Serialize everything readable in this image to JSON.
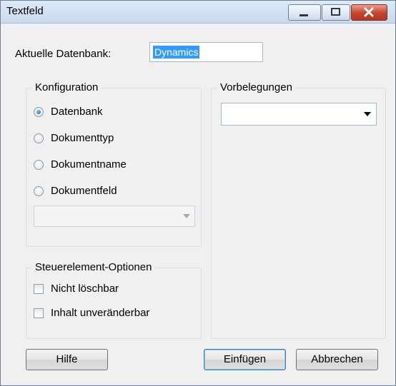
{
  "window": {
    "title": "Textfeld"
  },
  "database": {
    "label": "Aktuelle Datenbank:",
    "value": "Dynamics"
  },
  "configuration": {
    "title": "Konfiguration",
    "options": [
      {
        "label": "Datenbank",
        "selected": true
      },
      {
        "label": "Dokumenttyp",
        "selected": false
      },
      {
        "label": "Dokumentname",
        "selected": false
      },
      {
        "label": "Dokumentfeld",
        "selected": false
      }
    ],
    "combo_value": ""
  },
  "defaults": {
    "title": "Vorbelegungen",
    "combo_value": ""
  },
  "control_options": {
    "title": "Steuerelement-Optionen",
    "checkboxes": [
      {
        "label": "Nicht löschbar",
        "checked": false
      },
      {
        "label": "Inhalt unveränderbar",
        "checked": false
      }
    ]
  },
  "buttons": {
    "help": "Hilfe",
    "insert": "Einfügen",
    "cancel": "Abbrechen"
  },
  "icons": {
    "minimize": "minimize-icon",
    "maximize": "maximize-icon",
    "close": "close-icon",
    "dropdown": "chevron-down-icon"
  },
  "colors": {
    "title_bar": "#c9daef",
    "selection": "#3399ff",
    "close_button": "#c5432c"
  }
}
